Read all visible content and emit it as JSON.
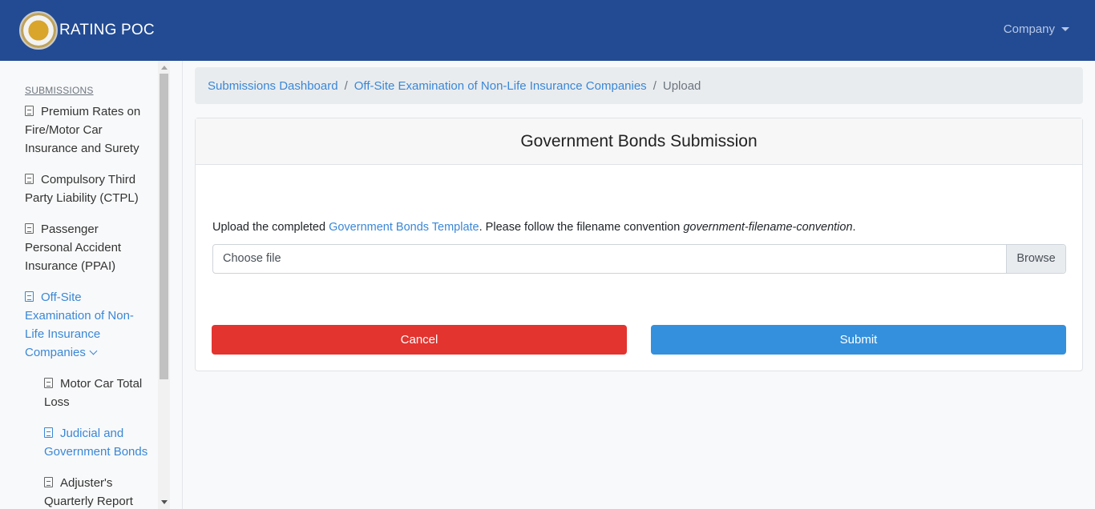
{
  "navbar": {
    "brand": "RATING POC",
    "company_menu": "Company"
  },
  "sidebar": {
    "heading": "SUBMISSIONS",
    "items": [
      {
        "label": "Premium Rates on Fire/Motor Car Insurance and Surety",
        "active": false
      },
      {
        "label": "Compulsory Third Party Liability (CTPL)",
        "active": false
      },
      {
        "label": "Passenger Personal Accident Insurance (PPAI)",
        "active": false
      },
      {
        "label": "Off-Site Examination of Non-Life Insurance Companies",
        "active": true
      }
    ],
    "subitems": [
      {
        "label": "Motor Car Total Loss",
        "active": false
      },
      {
        "label": "Judicial and Government Bonds",
        "active": true
      },
      {
        "label": "Adjuster's Quarterly Report",
        "active": false
      }
    ]
  },
  "breadcrumb": {
    "home": "Submissions Dashboard",
    "section": "Off-Site Examination of Non-Life Insurance Companies",
    "current": "Upload",
    "separator": "/"
  },
  "card": {
    "title": "Government Bonds Submission",
    "instruction_prefix": "Upload the completed ",
    "template_link": "Government Bonds Template",
    "instruction_middle": ". Please follow the filename convention ",
    "filename_convention": "government-filename-convention",
    "instruction_suffix": ".",
    "file_placeholder": "Choose file",
    "browse_label": "Browse",
    "cancel_label": "Cancel",
    "submit_label": "Submit"
  },
  "colors": {
    "navbar": "#234b93",
    "link": "#3a87d6",
    "cancel": "#e3342f",
    "submit": "#3490dc"
  }
}
